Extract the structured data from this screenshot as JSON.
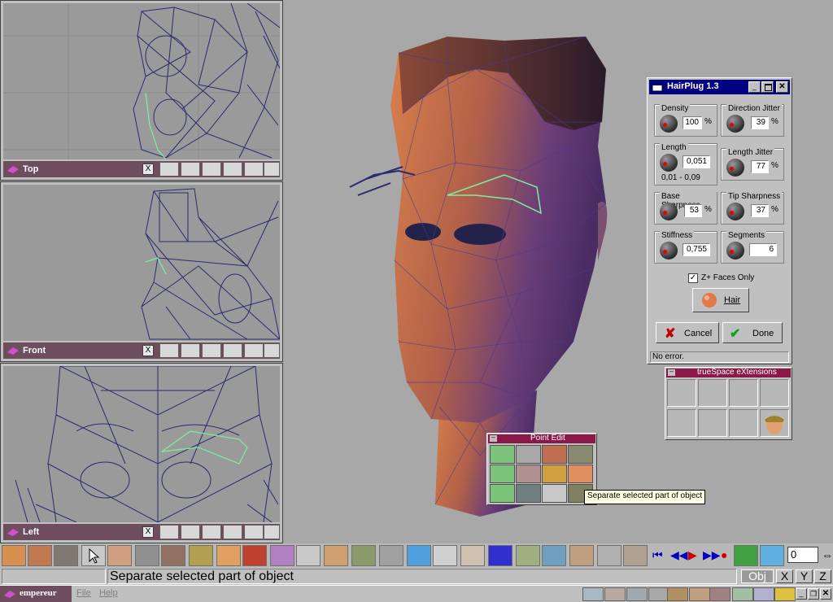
{
  "viewports": [
    {
      "label": "Top"
    },
    {
      "label": "Front"
    },
    {
      "label": "Left"
    }
  ],
  "close_glyph": "X",
  "hairplug": {
    "title": "HairPlug 1.3",
    "density_label": "Density",
    "density_value": "100",
    "density_unit": "%",
    "direction_jitter_label": "Direction Jitter",
    "direction_jitter_value": "39",
    "direction_jitter_unit": "%",
    "length_label": "Length",
    "length_value": "0,051",
    "length_range": "0,01 - 0,09",
    "length_jitter_label": "Length Jitter",
    "length_jitter_value": "77",
    "length_jitter_unit": "%",
    "base_sharpness_label": "Base Sharpness",
    "base_sharpness_value": "53",
    "base_sharpness_unit": "%",
    "tip_sharpness_label": "Tip Sharpness",
    "tip_sharpness_value": "37",
    "tip_sharpness_unit": "%",
    "stiffness_label": "Stiffness",
    "stiffness_value": "0,755",
    "segments_label": "Segments",
    "segments_value": "6",
    "zplus_label": "Z+ Faces Only",
    "zplus_checked": "✓",
    "hair_label": "Hair",
    "cancel_label": "Cancel",
    "done_label": "Done",
    "status": "No error."
  },
  "extensions": {
    "title": "trueSpace eXtensions"
  },
  "point_edit": {
    "title": "Point Edit"
  },
  "tooltip": "Separate selected part of object",
  "status_text": "Separate selected part of object",
  "frame_value": "0",
  "coord_buttons": {
    "obj": "Obj",
    "x": "X",
    "y": "Y",
    "z": "Z"
  },
  "taskbar": {
    "app": "empereur",
    "file": "File",
    "help": "Help"
  },
  "colors": {
    "accent": "#6e4d5e",
    "title_bar": "#000080",
    "ext_title": "#8a1848",
    "wire": "#2a2a6e",
    "select": "#7cf0a0"
  }
}
